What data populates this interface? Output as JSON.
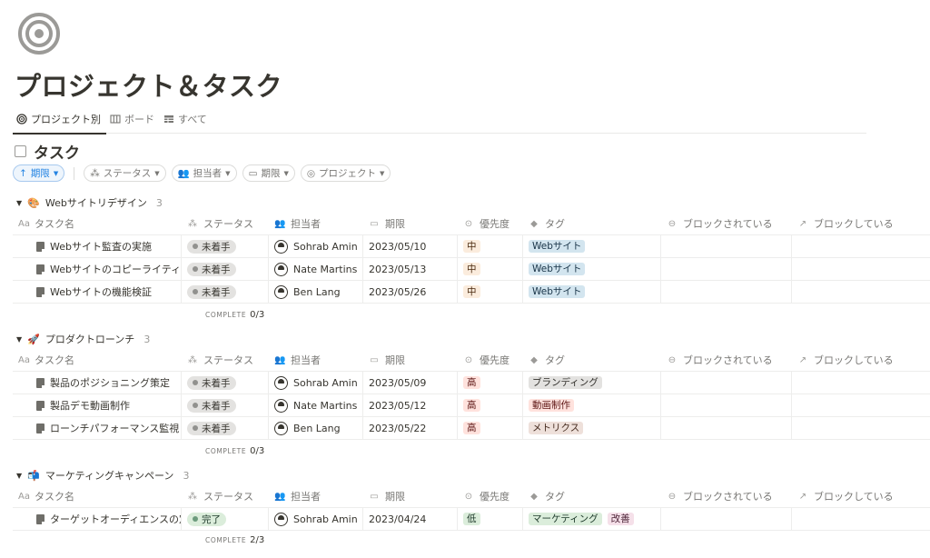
{
  "page": {
    "title": "プロジェクト＆タスク"
  },
  "views": [
    {
      "label": "プロジェクト別",
      "icon": "target-icon",
      "active": true
    },
    {
      "label": "ボード",
      "icon": "board-icon",
      "active": false
    },
    {
      "label": "すべて",
      "icon": "table-icon",
      "active": false
    }
  ],
  "database": {
    "title": "タスク"
  },
  "filters": {
    "sort": "期限",
    "status": "ステータス",
    "assignee": "担当者",
    "due": "期限",
    "project": "プロジェクト"
  },
  "columns": {
    "name": "タスク名",
    "name_prefix": "Aa",
    "status": "ステータス",
    "assignee": "担当者",
    "due": "期限",
    "priority": "優先度",
    "tags": "タグ",
    "blocked_by": "ブロックされている",
    "blocking": "ブロックしている"
  },
  "complete_label": "COMPLETE",
  "groups": [
    {
      "emoji": "🎨",
      "name": "Webサイトリデザイン",
      "count": "3",
      "complete": "0/3",
      "rows": [
        {
          "name": "Webサイト監査の実施",
          "status": "未着手",
          "assignee": "Sohrab Amin",
          "due": "2023/05/10",
          "priority": "中",
          "tags": [
            "Webサイト"
          ]
        },
        {
          "name": "Webサイトのコピーライティング",
          "status": "未着手",
          "assignee": "Nate Martins",
          "due": "2023/05/13",
          "priority": "中",
          "tags": [
            "Webサイト"
          ]
        },
        {
          "name": "Webサイトの機能検証",
          "status": "未着手",
          "assignee": "Ben Lang",
          "due": "2023/05/26",
          "priority": "中",
          "tags": [
            "Webサイト"
          ]
        }
      ]
    },
    {
      "emoji": "🚀",
      "name": "プロダクトローンチ",
      "count": "3",
      "complete": "0/3",
      "rows": [
        {
          "name": "製品のポジショニング策定",
          "status": "未着手",
          "assignee": "Sohrab Amin",
          "due": "2023/05/09",
          "priority": "高",
          "tags": [
            "ブランディング"
          ]
        },
        {
          "name": "製品デモ動画制作",
          "status": "未着手",
          "assignee": "Nate Martins",
          "due": "2023/05/12",
          "priority": "高",
          "tags": [
            "動画制作"
          ]
        },
        {
          "name": "ローンチパフォーマンス監視",
          "status": "未着手",
          "assignee": "Ben Lang",
          "due": "2023/05/22",
          "priority": "高",
          "tags": [
            "メトリクス"
          ]
        }
      ]
    },
    {
      "emoji": "📬",
      "name": "マーケティングキャンペーン",
      "count": "3",
      "complete": "2/3",
      "rows": [
        {
          "name": "ターゲットオーディエンスの定義",
          "status": "完了",
          "assignee": "Sohrab Amin",
          "due": "2023/04/24",
          "priority": "低",
          "tags": [
            "マーケティング",
            "改善"
          ]
        }
      ]
    }
  ],
  "colors": {
    "accent": "#2383e2",
    "text": "#37352f",
    "muted": "#787774"
  }
}
